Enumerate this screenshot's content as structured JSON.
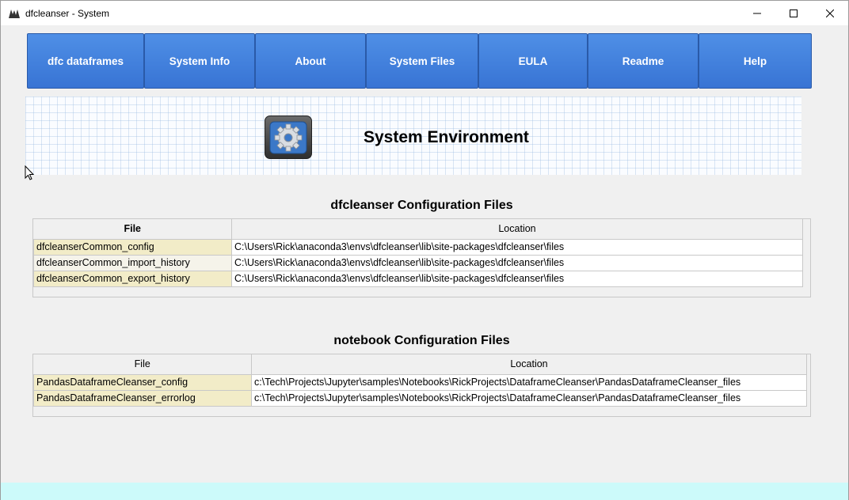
{
  "window": {
    "title": "dfcleanser - System",
    "minimize": "–",
    "maximize": "☐",
    "close": "✕"
  },
  "nav": {
    "buttons": [
      {
        "label": "dfc dataframes"
      },
      {
        "label": "System Info"
      },
      {
        "label": "About"
      },
      {
        "label": "System Files"
      },
      {
        "label": "EULA"
      },
      {
        "label": "Readme"
      },
      {
        "label": "Help"
      }
    ]
  },
  "banner": {
    "title": "System Environment",
    "icon": "gear-icon"
  },
  "dfc_config": {
    "title": "dfcleanser Configuration Files",
    "headers": [
      "File",
      "Location"
    ],
    "rows": [
      {
        "file": "dfcleanserCommon_config",
        "location": "C:\\Users\\Rick\\anaconda3\\envs\\dfcleanser\\lib\\site-packages\\dfcleanser\\files"
      },
      {
        "file": "dfcleanserCommon_import_history",
        "location": "C:\\Users\\Rick\\anaconda3\\envs\\dfcleanser\\lib\\site-packages\\dfcleanser\\files"
      },
      {
        "file": "dfcleanserCommon_export_history",
        "location": "C:\\Users\\Rick\\anaconda3\\envs\\dfcleanser\\lib\\site-packages\\dfcleanser\\files"
      }
    ]
  },
  "nb_config": {
    "title": "notebook Configuration Files",
    "headers": [
      "File",
      "Location"
    ],
    "rows": [
      {
        "file": "PandasDataframeCleanser_config",
        "location": "c:\\Tech\\Projects\\Jupyter\\samples\\Notebooks\\RickProjects\\DataframeCleanser\\PandasDataframeCleanser_files"
      },
      {
        "file": "PandasDataframeCleanser_errorlog",
        "location": "c:\\Tech\\Projects\\Jupyter\\samples\\Notebooks\\RickProjects\\DataframeCleanser\\PandasDataframeCleanser_files"
      }
    ]
  },
  "colors": {
    "nav_button": "#3f7fdc",
    "file_cell": "#f2ecc8",
    "status_bar": "#ccfafa"
  }
}
